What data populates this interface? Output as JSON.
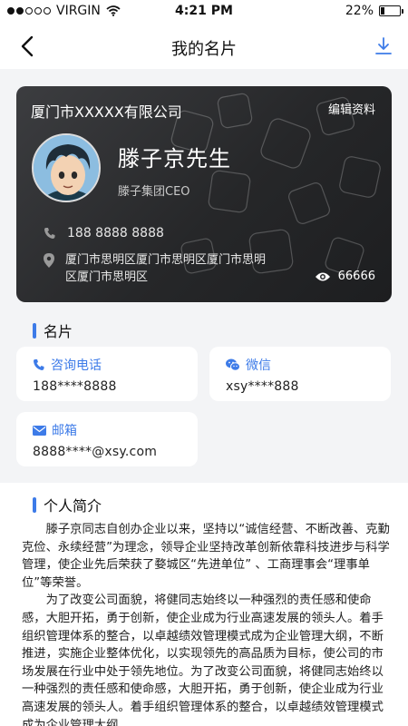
{
  "status_bar": {
    "carrier": "VIRGIN",
    "time": "4:21 PM",
    "battery": "22%",
    "battery_level": 0.22
  },
  "navbar": {
    "title": "我的名片"
  },
  "card": {
    "company": "厦门市XXXXX有限公司",
    "edit_label": "编辑资料",
    "name": "滕子京先生",
    "position": "滕子集团CEO",
    "phone": "188 8888 8888",
    "address": "厦门市思明区厦门市思明区厦门市思明区厦门市思明区",
    "views": "66666"
  },
  "contact": {
    "section_title": "名片",
    "items": [
      {
        "label": "咨询电话",
        "value": "188****8888",
        "icon": "phone-icon"
      },
      {
        "label": "微信",
        "value": "xsy****888",
        "icon": "wechat-icon"
      },
      {
        "label": "邮箱",
        "value": "8888****@xsy.com",
        "icon": "mail-icon"
      }
    ]
  },
  "intro": {
    "section_title": "个人简介",
    "paragraphs": [
      "滕子京同志自创办企业以来，坚持以“诚信经营、不断改善、克勤克俭、永续经营”为理念，领导企业坚持改革创新依靠科技进步与科学管理，使企业先后荣获了婺城区“先进单位” 、工商理事会“理事单位”等荣誉。",
      "为了改变公司面貌，将健同志始终以一种强烈的责任感和使命感，大胆开拓，勇于创新，使企业成为行业高速发展的领头人。着手组织管理体系的整合，以卓越绩效管理模式成为企业管理大纲，不断推进，实施企业整体优化，以实现领先的高品质为目标，使公司的市场发展在行业中处于领先地位。为了改变公司面貌，将健同志始终以一种强烈的责任感和使命感，大胆开拓，勇于创新，使企业成为行业高速发展的领头人。着手组织管理体系的整合，以卓越绩效管理模式成为企业管理大纲，"
    ]
  },
  "colors": {
    "accent": "#3d7be8",
    "card_dark": "#2a2b2d",
    "background": "#f3f4f6"
  }
}
